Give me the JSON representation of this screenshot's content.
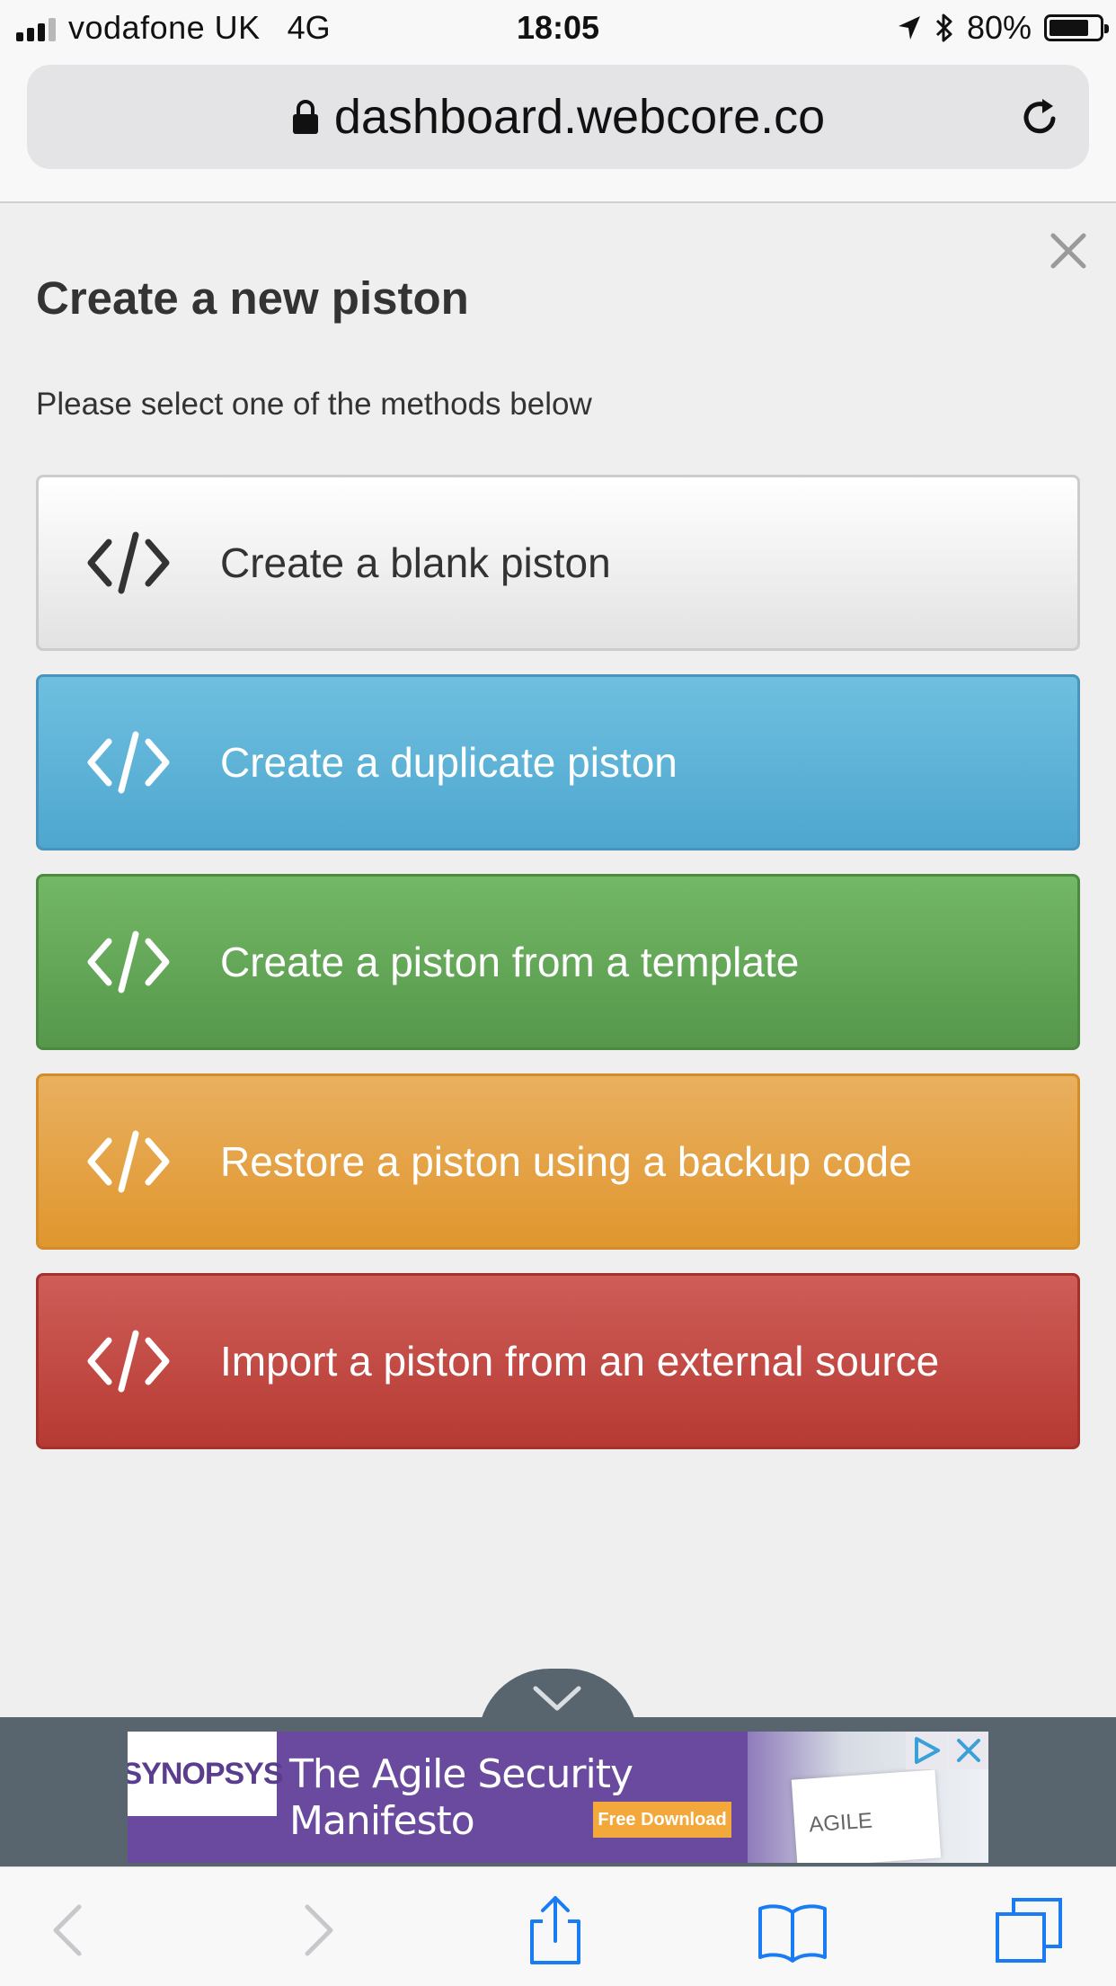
{
  "status_bar": {
    "carrier": "vodafone UK",
    "network": "4G",
    "time": "18:05",
    "battery_percent": "80%",
    "battery_level": 0.8,
    "icons": [
      "signal-icon",
      "location-arrow-icon",
      "bluetooth-icon",
      "battery-icon"
    ]
  },
  "browser": {
    "url": "dashboard.webcore.co",
    "icons": [
      "lock-icon",
      "reload-icon"
    ]
  },
  "modal": {
    "title": "Create a new piston",
    "subtitle": "Please select one of the methods below",
    "options": [
      {
        "label": "Create a blank piston",
        "icon": "code-icon",
        "style": "default"
      },
      {
        "label": "Create a duplicate piston",
        "icon": "code-icon",
        "style": "info",
        "color": "#5bb2d9"
      },
      {
        "label": "Create a piston from a template",
        "icon": "code-icon",
        "style": "success",
        "color": "#64a858"
      },
      {
        "label": "Restore a piston using a backup code",
        "icon": "code-icon",
        "style": "warning",
        "color": "#e4a344"
      },
      {
        "label": "Import a piston from an external source",
        "icon": "code-icon",
        "style": "danger",
        "color": "#c44b45"
      }
    ]
  },
  "ad": {
    "brand": "SYNOPSYS",
    "headline": "The Agile Security Manifesto",
    "cta": "Free Download",
    "book_text": "AGILE",
    "icons": [
      "chevron-down-icon",
      "adchoices-icon",
      "close-icon"
    ]
  },
  "toolbar": {
    "icons": [
      "back-icon",
      "forward-icon",
      "share-icon",
      "bookmarks-icon",
      "tabs-icon"
    ]
  }
}
